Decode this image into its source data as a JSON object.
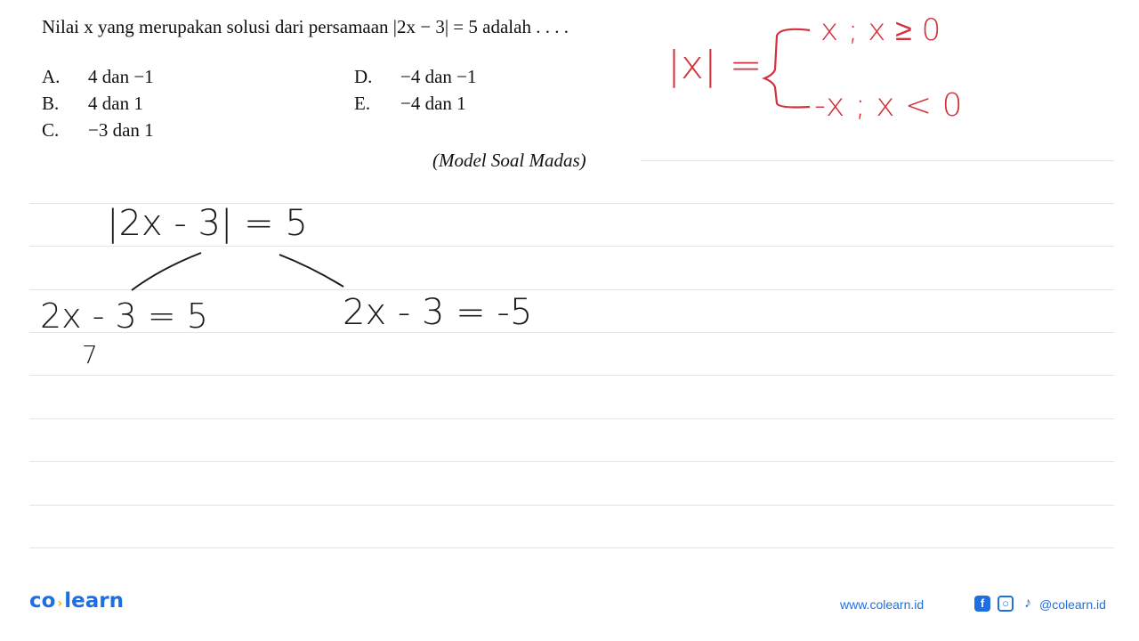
{
  "question": {
    "stem": "Nilai x yang merupakan solusi dari persamaan |2x − 3| = 5 adalah . . . .",
    "options": [
      {
        "letter": "A.",
        "text": "4 dan −1"
      },
      {
        "letter": "B.",
        "text": "4 dan 1"
      },
      {
        "letter": "C.",
        "text": "−3 dan 1"
      },
      {
        "letter": "D.",
        "text": "−4 dan −1"
      },
      {
        "letter": "E.",
        "text": "−4 dan 1"
      }
    ],
    "source": "(Model Soal Madas)"
  },
  "handwriting": {
    "abs_lhs": "|x| =",
    "case1": "x ; x ≥ 0",
    "case2": "-x ; x < 0",
    "equation": "|2x - 3| = 5",
    "branch_left": "2x - 3 = 5",
    "branch_right": "2x - 3 = -5",
    "partial": "7"
  },
  "colors": {
    "ink_red": "#d2323c",
    "brand_blue": "#1f6fe0",
    "brand_yellow": "#f7b500"
  },
  "footer": {
    "logo_left": "co",
    "logo_right": "learn",
    "website": "www.colearn.id",
    "social_handle": "@colearn.id",
    "icons": [
      "facebook-icon",
      "instagram-icon",
      "tiktok-icon"
    ]
  }
}
